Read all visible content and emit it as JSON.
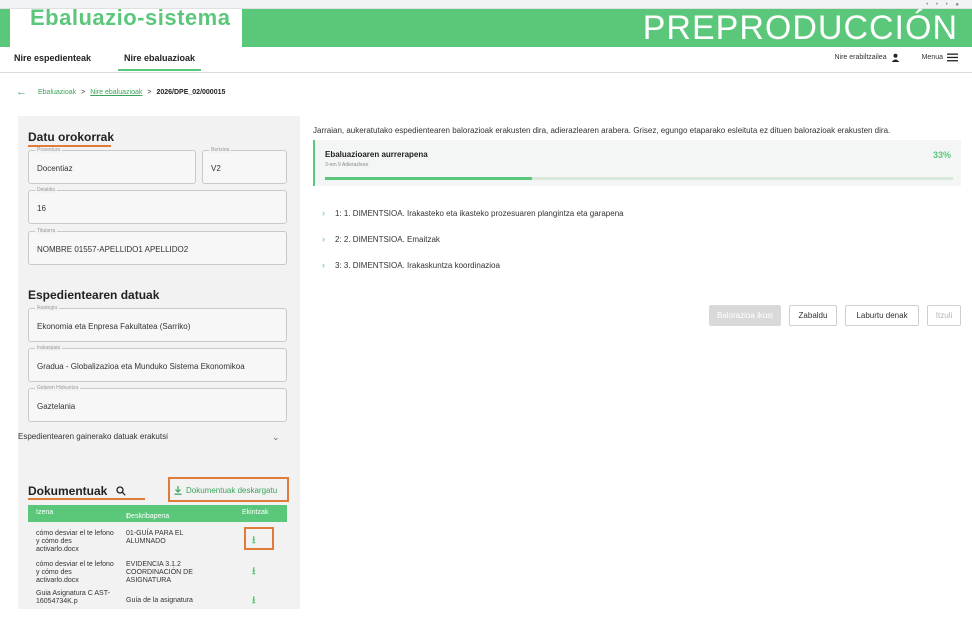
{
  "app": {
    "title": "Ebaluazio-sistema",
    "environment": "PREPRODUCCIÓN"
  },
  "nav": {
    "tabs": [
      {
        "label": "Nire espedienteak",
        "active": false
      },
      {
        "label": "Nire ebaluazioak",
        "active": true
      }
    ],
    "user_label": "Nire erabiltzailea",
    "menu_label": "Menua"
  },
  "breadcrumb": {
    "items": [
      "Ebaluazioak",
      "Nire ebaluazioak",
      "2026/DPE_02/000015"
    ]
  },
  "general": {
    "title": "Datu orokorrak",
    "procedure": {
      "label": "Prozedura",
      "value": "Docentiaz"
    },
    "version": {
      "label": "Bertsioa",
      "value": "V2"
    },
    "call": {
      "label": "Deialdia",
      "value": "16"
    },
    "holder": {
      "label": "Titularra",
      "value": "NOMBRE 01557-APELLIDO1 APELLIDO2"
    }
  },
  "file_data": {
    "title": "Espedientearen datuak",
    "faculty": {
      "label": "Ikastegia",
      "value": "Ekonomia eta Enpresa Fakultatea (Sarriko)"
    },
    "degree": {
      "label": "Irakaspaia",
      "value": "Gradua - Globalizazioa eta Munduko Sistema Ekonomikoa"
    },
    "language": {
      "label": "Gidaren Hizkuntza",
      "value": "Gaztelania"
    },
    "show_more": "Espedientearen gainerako datuak erakutsi"
  },
  "documents": {
    "title": "Dokumentuak",
    "download_label": "Dokumentuak deskargatu",
    "columns": [
      "Izena",
      "Deskribapena",
      "Ekintzak"
    ],
    "rows": [
      {
        "name": "cómo desviar el te lefono y cómo des activarlo.docx",
        "description": "01-GUÍA PARA EL ALUMNADO"
      },
      {
        "name": "cómo desviar el te lefono y cómo des activarlo.docx",
        "description": "EVIDENCIA 3.1.2 COORDINACIÓN DE ASIGNATURA"
      },
      {
        "name": "Guia Asignatura C AST-16054734K.p",
        "description": "Guía de la asignatura"
      }
    ]
  },
  "main": {
    "intro": "Jarraian, aukeratutako espedientearen balorazioak erakusten dira, adierazlearen arabera. Grisez, egungo etaparako esleituta ez dituen balorazioak erakusten dira.",
    "progress": {
      "title": "Ebaluazioaren aurrerapena",
      "subtitle": "3-ren 9 Adierazlean",
      "percent_label": "33%",
      "fraction": 0.33
    },
    "dimensions": [
      "1: 1. DIMENTSIOA. Irakasteko eta ikasteko prozesuaren plangintza eta garapena",
      "2: 2. DIMENTSIOA. Emaitzak",
      "3: 3. DIMENTSIOA. Irakaskuntza koordinazioa"
    ],
    "buttons": {
      "assess": "Balorazioa ikusi",
      "expand": "Zabaldu",
      "collapse_all": "Laburtu denak",
      "back": "Itzuli"
    }
  },
  "colors": {
    "brand": "#5bc77a",
    "highlight": "#e07b39"
  }
}
